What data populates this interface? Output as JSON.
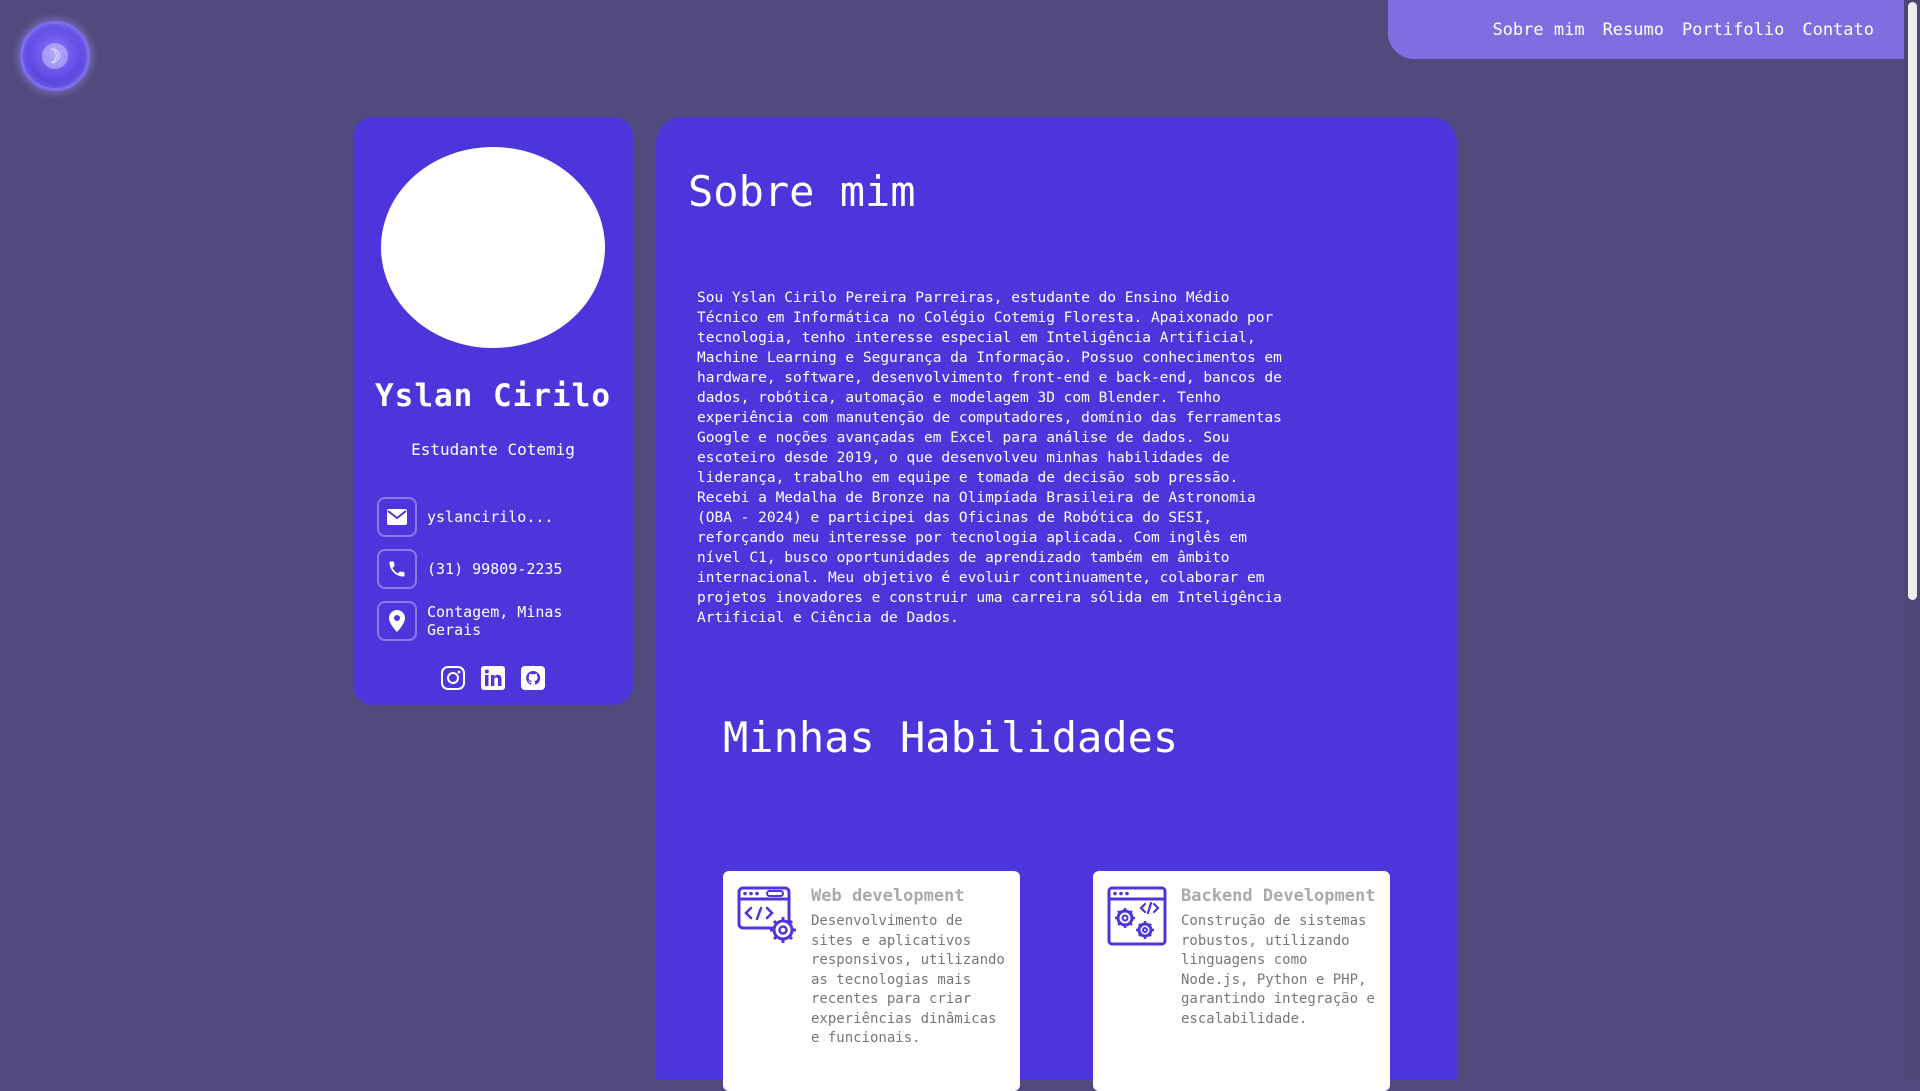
{
  "theme_toggle": {
    "icon": "moon-icon",
    "glyph": "☽"
  },
  "nav": {
    "items": [
      {
        "label": "Sobre mim"
      },
      {
        "label": "Resumo"
      },
      {
        "label": "Portifolio"
      },
      {
        "label": "Contato"
      }
    ]
  },
  "sidebar": {
    "name": "Yslan Cirilo",
    "role": "Estudante Cotemig",
    "contacts": {
      "email": "yslancirilo...",
      "phone": "(31) 99809-2235",
      "location": "Contagem, Minas Gerais"
    },
    "socials": [
      "instagram-icon",
      "linkedin-icon",
      "github-icon"
    ]
  },
  "main": {
    "about_title": "Sobre mim",
    "about_text": "Sou Yslan Cirilo Pereira Parreiras, estudante do Ensino Médio\nTécnico em Informática no Colégio Cotemig Floresta. Apaixonado por\ntecnologia, tenho interesse especial em Inteligência Artificial,\nMachine Learning e Segurança da Informação. Possuo conhecimentos em\nhardware, software, desenvolvimento front-end e back-end, bancos de\ndados, robótica, automação e modelagem 3D com Blender. Tenho\nexperiência com manutenção de computadores, domínio das ferramentas\nGoogle e noções avançadas em Excel para análise de dados. Sou\nescoteiro desde 2019, o que desenvolveu minhas habilidades de\nliderança, trabalho em equipe e tomada de decisão sob pressão.\nRecebi a Medalha de Bronze na Olimpíada Brasileira de Astronomia\n(OBA - 2024) e participei das Oficinas de Robótica do SESI,\nreforçando meu interesse por tecnologia aplicada. Com inglês em\nnível C1, busco oportunidades de aprendizado também em âmbito\ninternacional. Meu objetivo é evoluir continuamente, colaborar em\nprojetos inovadores e construir uma carreira sólida em Inteligência\nArtificial e Ciência de Dados.",
    "skills_title": "Minhas Habilidades",
    "skills": [
      {
        "title": "Web development",
        "description": "Desenvolvimento de sites e aplicativos responsivos, utilizando as tecnologias mais recentes para criar experiências dinâmicas e funcionais.",
        "icon": "web-code-gear-icon"
      },
      {
        "title": "Backend Development",
        "description": "Construção de sistemas robustos, utilizando linguagens como Node.js, Python e PHP, garantindo integração e escalabilidade.",
        "icon": "backend-code-gears-icon"
      }
    ]
  },
  "colors": {
    "background": "#514a7c",
    "panel": "#4b35db",
    "navbar": "#7f6ee0",
    "icon_accent": "#4b35db"
  }
}
